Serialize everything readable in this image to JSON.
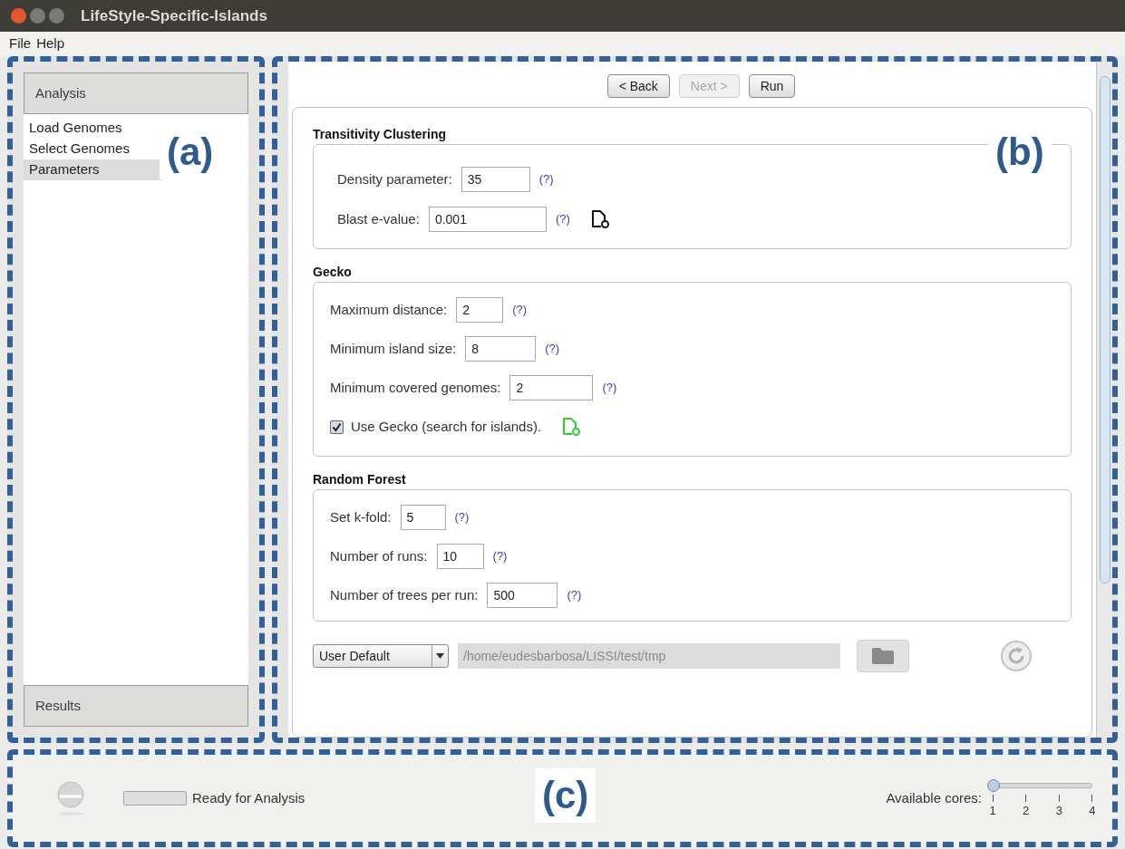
{
  "window": {
    "title": "LifeStyle-Specific-Islands"
  },
  "menu": [
    "File",
    "Help"
  ],
  "sidebar": {
    "header": "Analysis",
    "items": [
      {
        "label": "Load Genomes",
        "selected": false
      },
      {
        "label": "Select Genomes",
        "selected": false
      },
      {
        "label": "Parameters",
        "selected": true
      }
    ],
    "footer": "Results"
  },
  "wizard_buttons": [
    {
      "label": "< Back",
      "disabled": false
    },
    {
      "label": "Next >",
      "disabled": true
    },
    {
      "label": "Run",
      "disabled": false
    }
  ],
  "sections": [
    {
      "title": "Transitivity Clustering",
      "rows": [
        {
          "kind": "field",
          "label": "Density parameter:",
          "value": "35",
          "help": "(?)"
        },
        {
          "kind": "field",
          "label": "Blast e-value:",
          "value": "0.001",
          "help": "(?)",
          "file_icon": {
            "color": "#111111"
          }
        }
      ]
    },
    {
      "title": "Gecko",
      "rows": [
        {
          "kind": "field",
          "label": "Maximum distance:",
          "value": "2",
          "help": "(?)"
        },
        {
          "kind": "field",
          "label": "Minimum island size:",
          "value": "8",
          "help": "(?)"
        },
        {
          "kind": "field",
          "label": "Minimum covered genomes:",
          "value": "2",
          "help": "(?)"
        },
        {
          "kind": "checkbox",
          "label": "Use Gecko (search for islands).",
          "checked": true,
          "file_icon": {
            "color": "#33cc33"
          }
        }
      ]
    },
    {
      "title": "Random Forest",
      "rows": [
        {
          "kind": "field",
          "label": "Set k-fold:",
          "value": "5",
          "help": "(?)"
        },
        {
          "kind": "field",
          "label": "Number of runs:",
          "value": "10",
          "help": "(?)"
        },
        {
          "kind": "field",
          "label": "Number of trees per run:",
          "value": "500",
          "help": "(?)"
        }
      ]
    }
  ],
  "output": {
    "profile": "User Default",
    "path": "/home/eudesbarbosa/LISSI/test/tmp"
  },
  "status_bar": {
    "progress": {
      "level": 0
    },
    "message": "Ready for Analysis",
    "cores_label": "Available cores:",
    "cores_slider": {
      "level": 0,
      "ticks": [
        "1",
        "2",
        "3",
        "4"
      ]
    }
  },
  "annotations": [
    "(a)",
    "(b)",
    "(c)"
  ]
}
